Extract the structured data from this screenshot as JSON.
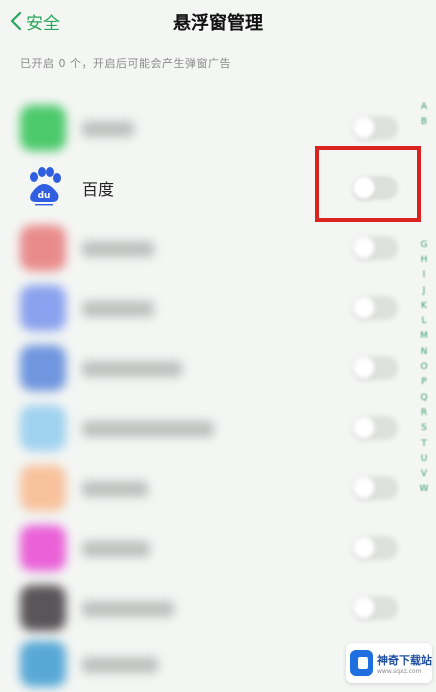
{
  "header": {
    "back_label": "安全",
    "title": "悬浮窗管理"
  },
  "hint": "已开启 0 个，开启后可能会产生弹窗广告",
  "apps": [
    {
      "name": "",
      "icon_color": "#4cc96a",
      "toggled": false
    },
    {
      "name": "百度",
      "icon_color": "#2f5fe0",
      "toggled": false
    },
    {
      "name": "",
      "icon_color": "#e98b8b",
      "toggled": false
    },
    {
      "name": "",
      "icon_color": "#8aa2ef",
      "toggled": false
    },
    {
      "name": "",
      "icon_color": "#6f96df",
      "toggled": false
    },
    {
      "name": "",
      "icon_color": "#9fd2ef",
      "toggled": false
    },
    {
      "name": "",
      "icon_color": "#f7c29d",
      "toggled": false
    },
    {
      "name": "",
      "icon_color": "#ea62d8",
      "toggled": false
    },
    {
      "name": "",
      "icon_color": "#5a5558",
      "toggled": false
    },
    {
      "name": "",
      "icon_color": "#58a8d6",
      "toggled": false
    }
  ],
  "index_letters": [
    "A",
    "B",
    "",
    "",
    "",
    "",
    "",
    "",
    "",
    "G",
    "H",
    "I",
    "J",
    "K",
    "L",
    "M",
    "N",
    "O",
    "P",
    "Q",
    "R",
    "S",
    "T",
    "U",
    "V",
    "W"
  ],
  "watermark": {
    "main": "神奇下载站",
    "sub": "www.sqxz.com"
  },
  "accent": "#27a55a",
  "highlight_color": "#d9231f"
}
